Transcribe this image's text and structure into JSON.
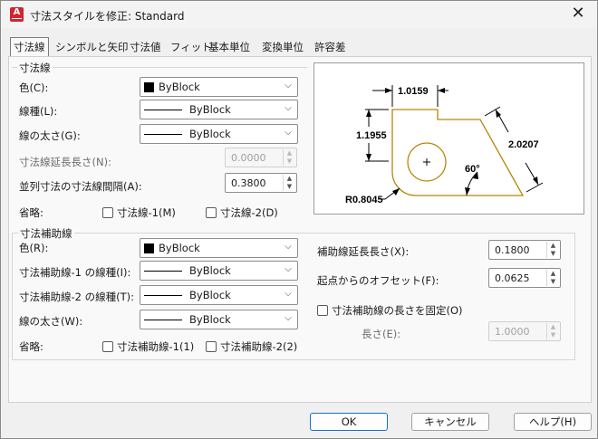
{
  "window": {
    "title": "寸法スタイルを修正: Standard",
    "app_icon_letter": "A"
  },
  "tabs": [
    "寸法線",
    "シンボルと矢印",
    "寸法値",
    "フィット",
    "基本単位",
    "変換単位",
    "許容差"
  ],
  "dim_line": {
    "group_label": "寸法線",
    "color_label": "色(C):",
    "color_value": "ByBlock",
    "linetype_label": "線種(L):",
    "linetype_value": "ByBlock",
    "lineweight_label": "線の太さ(G):",
    "lineweight_value": "ByBlock",
    "extension_label": "寸法線延長長さ(N):",
    "extension_value": "0.0000",
    "baseline_label": "並列寸法の寸法線間隔(A):",
    "baseline_value": "0.3800",
    "suppress_label": "省略:",
    "suppress_1": "寸法線-1(M)",
    "suppress_2": "寸法線-2(D)"
  },
  "ext_line": {
    "group_label": "寸法補助線",
    "color_label": "色(R):",
    "color_value": "ByBlock",
    "linetype1_label": "寸法補助線-1 の線種(I):",
    "linetype1_value": "ByBlock",
    "linetype2_label": "寸法補助線-2 の線種(T):",
    "linetype2_value": "ByBlock",
    "lineweight_label": "線の太さ(W):",
    "lineweight_value": "ByBlock",
    "suppress_label": "省略:",
    "suppress_1": "寸法補助線-1(1)",
    "suppress_2": "寸法補助線-2(2)",
    "extend_label": "補助線延長長さ(X):",
    "extend_value": "0.1800",
    "offset_label": "起点からのオフセット(F):",
    "offset_value": "0.0625",
    "fixed_label": "寸法補助線の長さを固定(O)",
    "length_label": "長さ(E):",
    "length_value": "1.0000"
  },
  "preview": {
    "dim_top": "1.0159",
    "dim_left": "1.1955",
    "dim_right": "2.0207",
    "angle": "60°",
    "radius": "R0.8045"
  },
  "buttons": {
    "ok": "OK",
    "cancel": "キャンセル",
    "help": "ヘルプ(H)"
  },
  "colors": {
    "accent": "#1a6fd1",
    "app_icon": "#d32431",
    "preview_outline": "#b8860b"
  }
}
